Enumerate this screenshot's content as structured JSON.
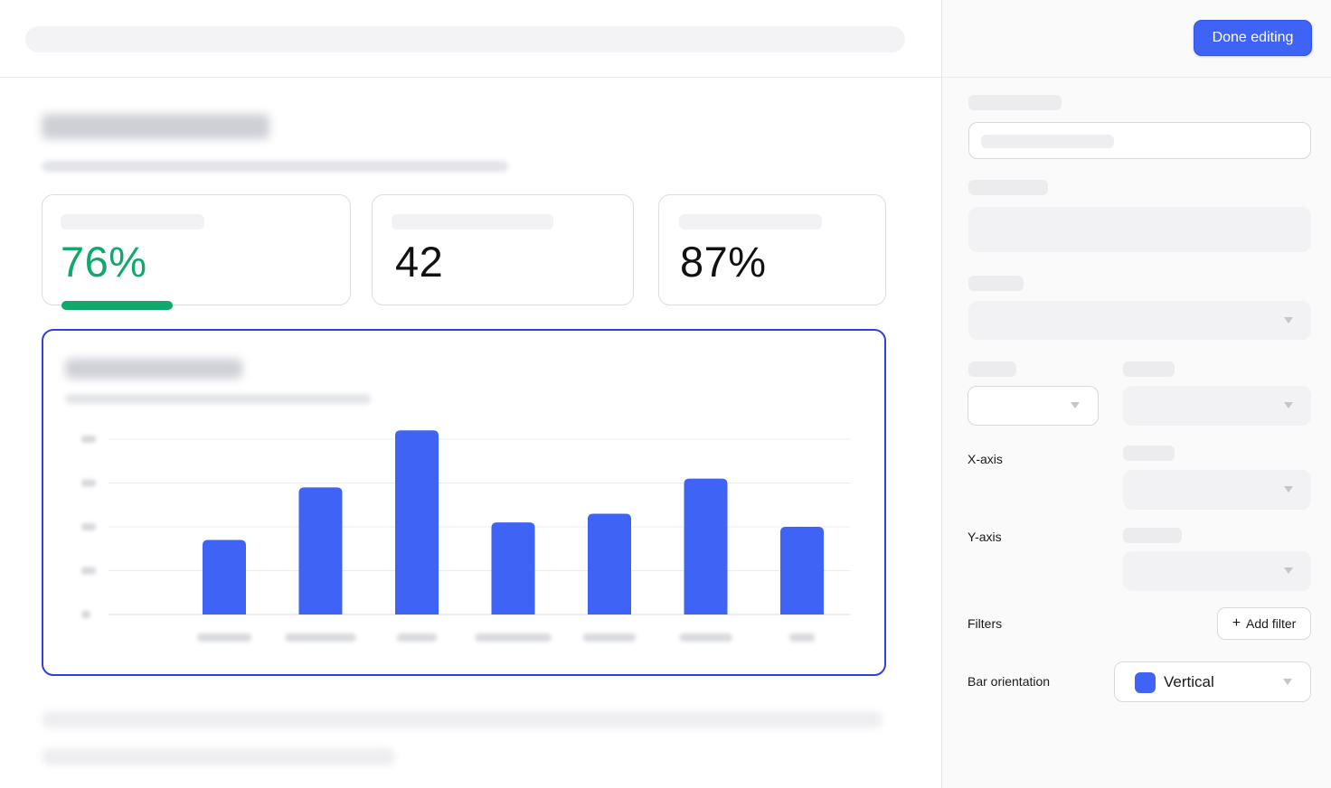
{
  "toolbar": {
    "done_label": "Done editing"
  },
  "kpis": [
    {
      "value": "76%",
      "progress_percent": 41,
      "accent": "#10a86b"
    },
    {
      "value": "42"
    },
    {
      "value": "87%"
    }
  ],
  "panel": {
    "x_axis_label": "X-axis",
    "y_axis_label": "Y-axis",
    "filters_label": "Filters",
    "add_filter_label": "Add filter",
    "add_filter_icon": "plus-icon",
    "orientation_label": "Bar orientation",
    "orientation_value": "Vertical",
    "orientation_color": "#3e63f5"
  },
  "colors": {
    "accent": "#3e63f5",
    "selection_border": "#2f3fe0",
    "success": "#10a86b"
  },
  "chart_data": {
    "type": "bar",
    "orientation": "vertical",
    "categories": [
      "",
      "",
      "",
      "",
      "",
      "",
      ""
    ],
    "values": [
      17,
      29,
      42,
      21,
      23,
      31,
      20
    ],
    "ylim": [
      0,
      40
    ],
    "grid": true,
    "color": "#3e63f5",
    "title": "",
    "xlabel": "",
    "ylabel": ""
  }
}
